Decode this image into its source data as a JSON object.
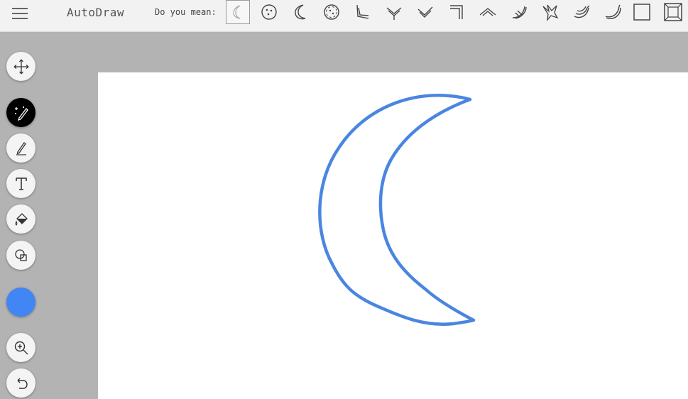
{
  "app": {
    "title": "AutoDraw"
  },
  "suggestions": {
    "label": "Do you mean:",
    "items": [
      {
        "icon": "crescent-icon",
        "selected": true
      },
      {
        "icon": "cookie-icon"
      },
      {
        "icon": "moon-icon"
      },
      {
        "icon": "pizza-icon"
      },
      {
        "icon": "elbow-pipe-icon"
      },
      {
        "icon": "fish-arrow-icon"
      },
      {
        "icon": "check-arrow-icon"
      },
      {
        "icon": "hook-icon"
      },
      {
        "icon": "chevron-mustache-icon"
      },
      {
        "icon": "banana-peel-icon"
      },
      {
        "icon": "bird-icon"
      },
      {
        "icon": "banana-bunch-icon"
      },
      {
        "icon": "banana-icon"
      },
      {
        "icon": "square-icon"
      },
      {
        "icon": "framed-square-icon"
      }
    ]
  },
  "tools": [
    {
      "name": "move-tool",
      "icon": "move-icon"
    },
    {
      "name": "autodraw-tool",
      "icon": "magic-pencil-icon",
      "active": true
    },
    {
      "name": "draw-tool",
      "icon": "pencil-icon"
    },
    {
      "name": "type-tool",
      "icon": "text-icon"
    },
    {
      "name": "fill-tool",
      "icon": "paint-bucket-icon"
    },
    {
      "name": "shape-tool",
      "icon": "shapes-icon"
    },
    {
      "name": "zoom-tool",
      "icon": "zoom-in-icon"
    },
    {
      "name": "undo-tool",
      "icon": "undo-icon"
    }
  ],
  "colors": {
    "stroke": "#4a86e0",
    "current_color": "#4285f4",
    "topbar": "#f2f2f2",
    "workspace": "#b3b3b3"
  }
}
